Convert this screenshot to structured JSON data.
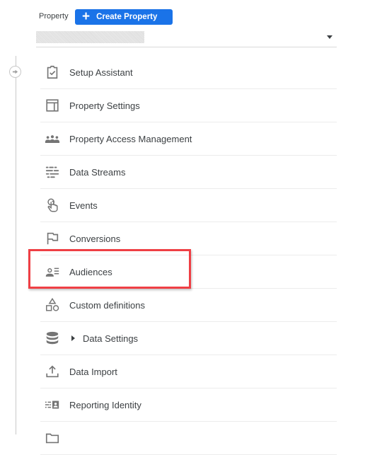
{
  "header": {
    "property_label": "Property",
    "create_button_label": "Create Property",
    "create_button_icon": "plus-icon",
    "property_selector_value": "",
    "selector_icon": "dropdown-caret-icon"
  },
  "colors": {
    "accent": "#1a73e8",
    "highlight": "#ef3f45",
    "text": "#3c4043",
    "icon": "#757575"
  },
  "menu": {
    "items": [
      {
        "label": "Setup Assistant",
        "icon": "clipboard-check-icon"
      },
      {
        "label": "Property Settings",
        "icon": "layout-panel-icon"
      },
      {
        "label": "Property Access Management",
        "icon": "people-group-icon"
      },
      {
        "label": "Data Streams",
        "icon": "data-streams-icon"
      },
      {
        "label": "Events",
        "icon": "touch-hand-icon"
      },
      {
        "label": "Conversions",
        "icon": "flag-icon"
      },
      {
        "label": "Audiences",
        "icon": "audience-list-icon",
        "highlighted": true
      },
      {
        "label": "Custom definitions",
        "icon": "shapes-icon"
      },
      {
        "label": "Data Settings",
        "icon": "database-icon",
        "expandable": true
      },
      {
        "label": "Data Import",
        "icon": "upload-icon"
      },
      {
        "label": "Reporting Identity",
        "icon": "reporting-identity-icon"
      },
      {
        "label": "",
        "icon": "folder-icon"
      }
    ]
  }
}
